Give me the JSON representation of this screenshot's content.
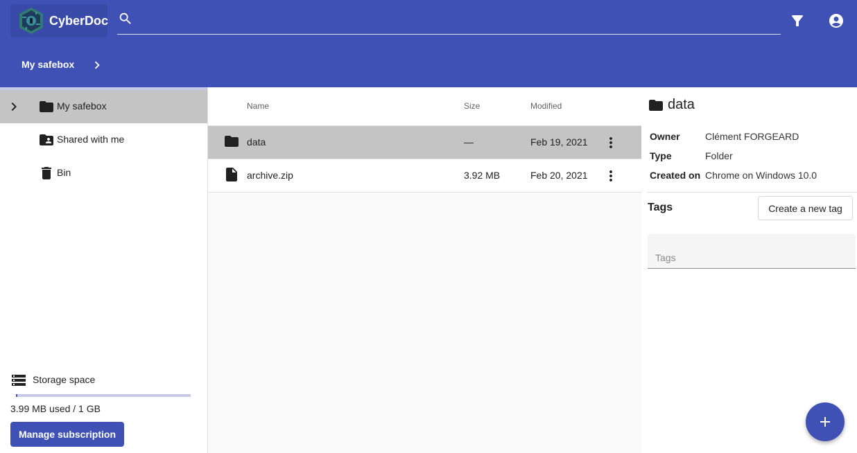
{
  "app": {
    "name": "CyberDoc"
  },
  "search": {
    "placeholder": ""
  },
  "header": {
    "filter_icon": "filter-icon",
    "account_icon": "account-circle-icon",
    "breadcrumb": [
      "My safebox"
    ]
  },
  "sidebar": {
    "items": [
      {
        "label": "My safebox",
        "icon": "folder-icon",
        "active": true
      },
      {
        "label": "Shared with me",
        "icon": "folder-shared-icon",
        "active": false
      },
      {
        "label": "Bin",
        "icon": "trash-icon",
        "active": false
      }
    ],
    "storage": {
      "label": "Storage space",
      "used_text": "3.99 MB used / 1 GB",
      "fraction_used": 0.004
    },
    "manage_label": "Manage subscription"
  },
  "table": {
    "headers": {
      "name": "Name",
      "size": "Size",
      "modified": "Modified"
    },
    "rows": [
      {
        "name": "data",
        "size": "—",
        "modified": "Feb 19, 2021",
        "icon": "folder-icon",
        "selected": true
      },
      {
        "name": "archive.zip",
        "size": "3.92 MB",
        "modified": "Feb 20, 2021",
        "icon": "file-icon",
        "selected": false
      }
    ]
  },
  "details": {
    "title": "data",
    "fields": [
      {
        "key": "Owner",
        "value": "Clément FORGEARD"
      },
      {
        "key": "Type",
        "value": "Folder"
      },
      {
        "key": "Created on",
        "value": "Chrome on Windows 10.0"
      }
    ],
    "tags_title": "Tags",
    "create_tag_label": "Create a new tag",
    "tags_placeholder": "Tags"
  },
  "colors": {
    "primary": "#3f51b5",
    "selected_row": "#c4c4c4"
  }
}
